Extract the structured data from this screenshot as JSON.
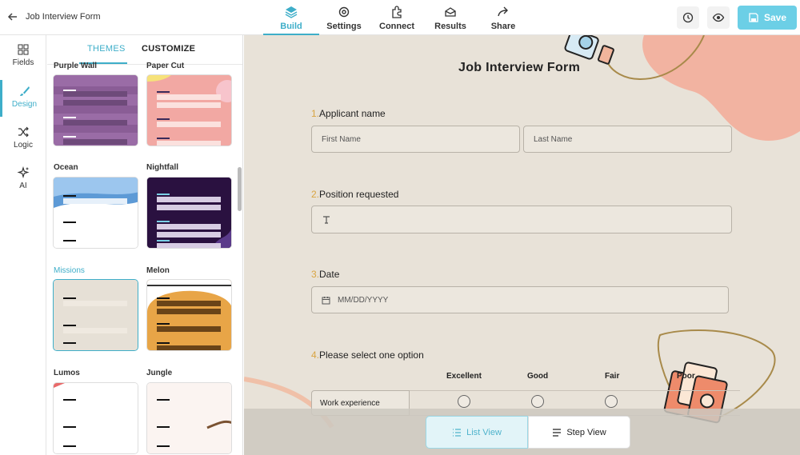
{
  "header": {
    "form_title": "Job Interview Form",
    "tabs": [
      {
        "label": "Build",
        "icon": "layers-icon",
        "active": true
      },
      {
        "label": "Settings",
        "icon": "gear-icon",
        "active": false
      },
      {
        "label": "Connect",
        "icon": "puzzle-icon",
        "active": false
      },
      {
        "label": "Results",
        "icon": "inbox-icon",
        "active": false
      },
      {
        "label": "Share",
        "icon": "share-arrow-icon",
        "active": false
      }
    ],
    "save_label": "Save"
  },
  "rail": {
    "items": [
      {
        "label": "Fields",
        "icon": "grid-icon"
      },
      {
        "label": "Design",
        "icon": "brush-icon",
        "active": true
      },
      {
        "label": "Logic",
        "icon": "shuffle-icon"
      },
      {
        "label": "AI",
        "icon": "sparkle-icon"
      }
    ]
  },
  "panel": {
    "tab_themes": "THEMES",
    "tab_customize": "CUSTOMIZE",
    "themes": [
      {
        "name": "Purple Wall"
      },
      {
        "name": "Paper Cut"
      },
      {
        "name": "Ocean"
      },
      {
        "name": "Nightfall"
      },
      {
        "name": "Missions",
        "selected": true
      },
      {
        "name": "Melon"
      },
      {
        "name": "Lumos"
      },
      {
        "name": "Jungle"
      }
    ]
  },
  "form": {
    "title": "Job Interview Form",
    "q1": {
      "num": "1.",
      "label": "Applicant name",
      "first_placeholder": "First Name",
      "last_placeholder": "Last Name"
    },
    "q2": {
      "num": "2.",
      "label": "Position requested",
      "icon": "text-cursor-icon"
    },
    "q3": {
      "num": "3.",
      "label": "Date",
      "placeholder": "MM/DD/YYYY"
    },
    "q4": {
      "num": "4.",
      "label": "Please select one option",
      "columns": [
        "Excellent",
        "Good",
        "Fair",
        "Poor"
      ],
      "rows": [
        "Work experience"
      ]
    }
  },
  "view_toggle": {
    "list_label": "List View",
    "step_label": "Step View"
  },
  "colors": {
    "accent": "#3eaec9",
    "save": "#6ccfe6",
    "canvas_bg": "#e8e2d8",
    "question_number": "#d9a441"
  }
}
